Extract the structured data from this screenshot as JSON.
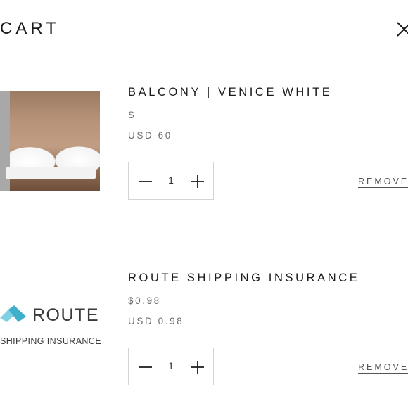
{
  "header": {
    "title": "CART"
  },
  "items": [
    {
      "name": "BALCONY | VENICE WHITE",
      "variant": "S",
      "price": "USD 60",
      "quantity": "1",
      "remove_label": "REMOVE"
    },
    {
      "name": "ROUTE SHIPPING INSURANCE",
      "variant": "$0.98",
      "price": "USD 0.98",
      "quantity": "1",
      "remove_label": "REMOVE",
      "logo": {
        "wordmark": "ROUTE",
        "tagline": "SHIPPING INSURANCE"
      }
    }
  ],
  "icons": {
    "close": "close-icon",
    "minus": "minus-icon",
    "plus": "plus-icon"
  },
  "colors": {
    "text": "#1a1a1a",
    "muted": "#6b6b6b",
    "border": "#d4d4d4",
    "route_teal": "#4bb8d0"
  }
}
